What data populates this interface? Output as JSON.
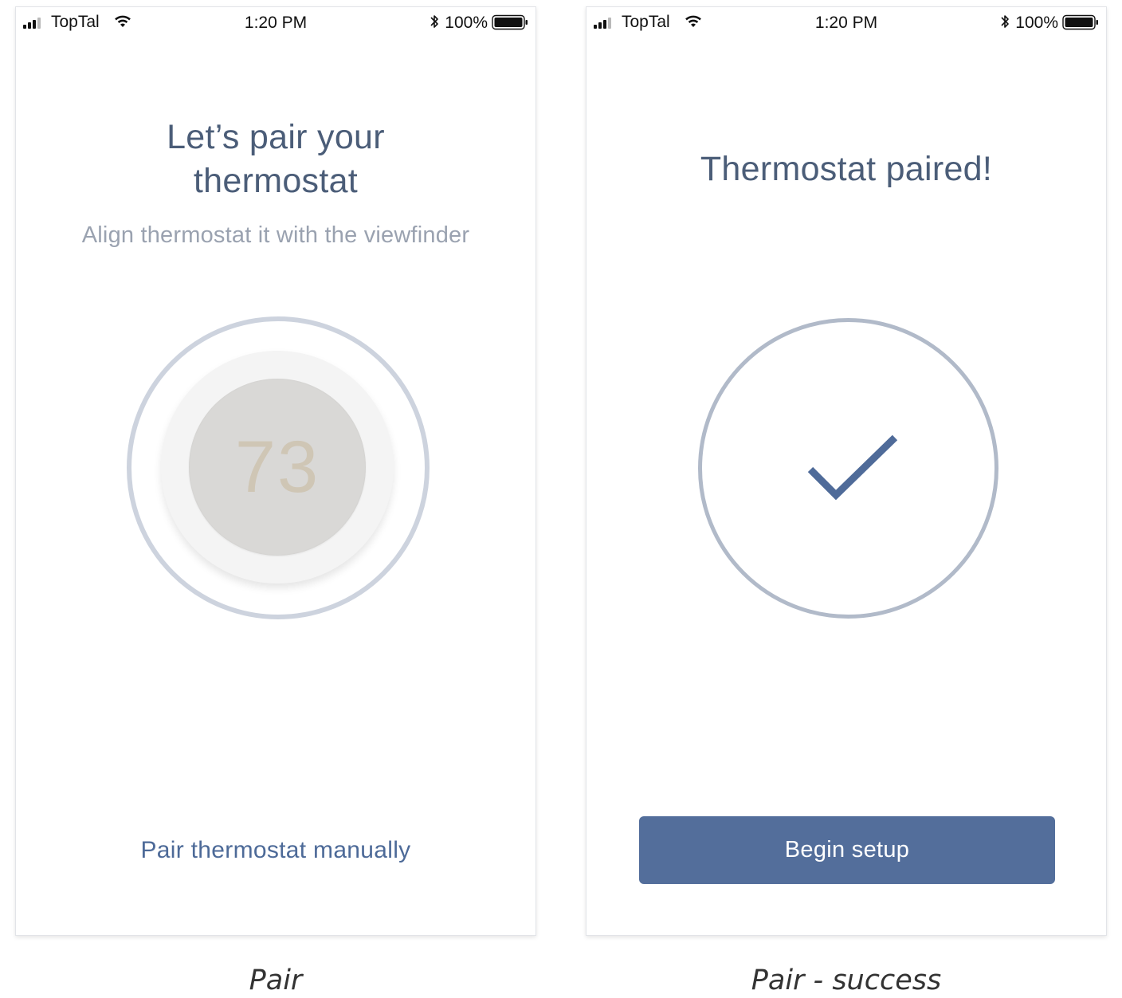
{
  "status_bar": {
    "carrier": "TopTal",
    "time": "1:20 PM",
    "battery_percent": "100%",
    "signal_bars": 3,
    "signal_bars_total": 4,
    "icons": [
      "signal-icon",
      "wifi-icon",
      "bluetooth-icon",
      "battery-icon"
    ]
  },
  "pair_screen": {
    "title_line1": "Let’s pair your",
    "title_line2": "thermostat",
    "subtitle": "Align thermostat it with the viewfinder",
    "thermostat_reading": "73",
    "manual_link": "Pair thermostat manually"
  },
  "success_screen": {
    "title": "Thermostat paired!",
    "icon": "checkmark-icon",
    "button_label": "Begin setup"
  },
  "captions": {
    "pair": "Pair",
    "success": "Pair - success"
  },
  "colors": {
    "title_text": "#4b5d78",
    "subtitle_text": "#9aa2b0",
    "link": "#4d6a98",
    "primary_button": "#536e9b",
    "check": "#4f6b99",
    "viewfinder_ring": "#cdd3de",
    "success_ring": "#b1bac9"
  }
}
